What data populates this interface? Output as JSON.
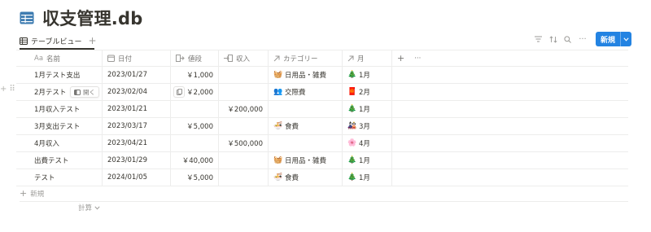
{
  "page": {
    "title": "収支管理.db",
    "icon": "table-icon"
  },
  "view": {
    "tab_label": "テーブルビュー",
    "add_view_label": "+",
    "new_button_label": "新規"
  },
  "table": {
    "columns": [
      {
        "label": "名前",
        "icon": "aa-icon"
      },
      {
        "label": "日付",
        "icon": "calendar-icon"
      },
      {
        "label": "値段",
        "icon": "outflow-icon"
      },
      {
        "label": "収入",
        "icon": "inflow-icon"
      },
      {
        "label": "カテゴリー",
        "icon": "relation-arrow-icon"
      },
      {
        "label": "月",
        "icon": "relation-arrow-icon"
      }
    ],
    "aa_label": "Aa",
    "rows": [
      {
        "name": "1月テスト支出",
        "date": "2023/01/27",
        "price": "￥1,000",
        "income": "",
        "category": "日用品・雑費",
        "category_icon": "daily-goods-icon",
        "month": "1月",
        "month_icon": "tree-icon"
      },
      {
        "name": "2月テスト",
        "date": "2023/02/04",
        "price": "￥2,000",
        "income": "",
        "category": "交際費",
        "category_icon": "people-icon",
        "month": "2月",
        "month_icon": "red-tag-icon"
      },
      {
        "name": "1月収入テスト",
        "date": "2023/01/21",
        "price": "",
        "income": "￥200,000",
        "category": "",
        "category_icon": "",
        "month": "1月",
        "month_icon": "tree-icon"
      },
      {
        "name": "3月支出テスト",
        "date": "2023/03/17",
        "price": "￥5,000",
        "income": "",
        "category": "食費",
        "category_icon": "food-icon",
        "month": "3月",
        "month_icon": "dolls-icon"
      },
      {
        "name": "4月収入",
        "date": "2023/04/21",
        "price": "",
        "income": "￥500,000",
        "category": "",
        "category_icon": "",
        "month": "4月",
        "month_icon": "blossom-icon"
      },
      {
        "name": "出費テスト",
        "date": "2023/01/29",
        "price": "￥40,000",
        "income": "",
        "category": "日用品・雑費",
        "category_icon": "daily-goods-icon",
        "month": "1月",
        "month_icon": "tree-icon"
      },
      {
        "name": "テスト",
        "date": "2024/01/05",
        "price": "￥5,000",
        "income": "",
        "category": "食費",
        "category_icon": "food-icon",
        "month": "1月",
        "month_icon": "tree-icon"
      }
    ],
    "open_label": "開く",
    "new_row_label": "新規",
    "calc_label": "計算"
  },
  "colors": {
    "accent": "#2383e2",
    "text": "#37352f",
    "muted": "#9b9a97",
    "border": "#ededec"
  }
}
